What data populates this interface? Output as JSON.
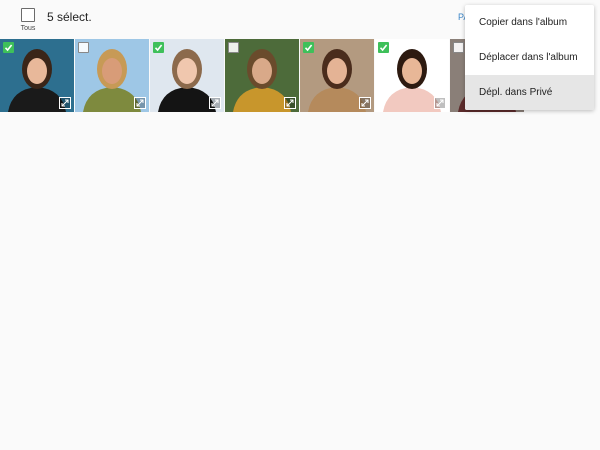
{
  "header": {
    "select_all_label": "Tous",
    "selection_count": "5 sélect.",
    "partial_action": "PA"
  },
  "photos": [
    {
      "checked": true,
      "bg": "#2d6f8f",
      "skin": "#e8b89a",
      "hair": "#3a2518",
      "clothes": "#1a1a1a"
    },
    {
      "checked": false,
      "bg": "#9ec7e6",
      "skin": "#d89c78",
      "hair": "#c79a56",
      "clothes": "#7e8a3e"
    },
    {
      "checked": true,
      "bg": "#dfe7ef",
      "skin": "#f0c7ae",
      "hair": "#8c6a4c",
      "clothes": "#141414"
    },
    {
      "checked": false,
      "bg": "#4d6b3a",
      "skin": "#d9a989",
      "hair": "#6a4b2c",
      "clothes": "#c8962c"
    },
    {
      "checked": true,
      "bg": "#b39a80",
      "skin": "#e4b395",
      "hair": "#4a2c1c",
      "clothes": "#b58a5c"
    },
    {
      "checked": true,
      "bg": "#ffffff",
      "skin": "#e8b797",
      "hair": "#2d1a10",
      "clothes": "#f2c9c0"
    },
    {
      "checked": false,
      "bg": "#8a7f78",
      "skin": "#d8a88a",
      "hair": "#2b2b2b",
      "clothes": "#5c2b2b"
    }
  ],
  "menu": {
    "items": [
      {
        "label": "Copier dans l'album",
        "highlighted": false
      },
      {
        "label": "Déplacer dans l'album",
        "highlighted": false
      },
      {
        "label": "Dépl. dans Privé",
        "highlighted": true
      }
    ]
  },
  "colors": {
    "check_green": "#3ec05a",
    "accent_blue": "#3b86c8"
  }
}
